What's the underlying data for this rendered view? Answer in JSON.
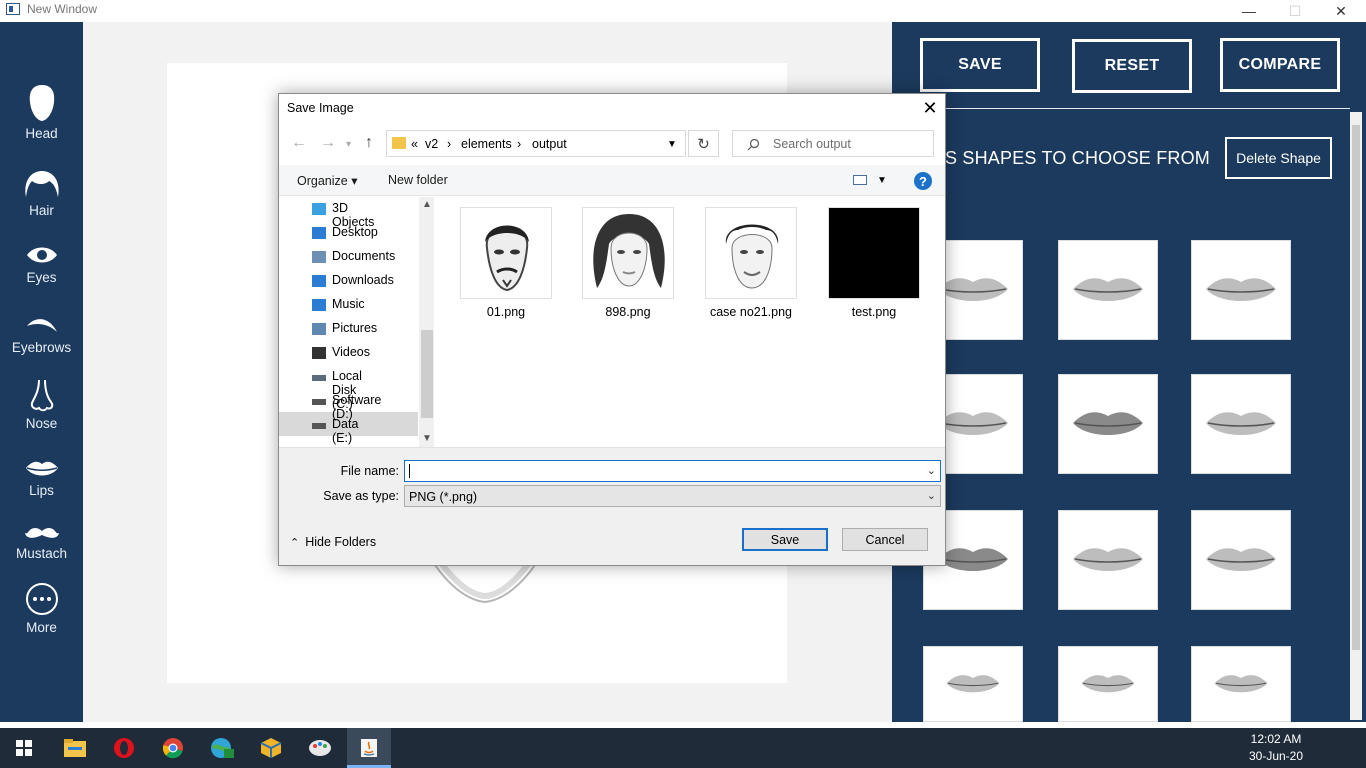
{
  "window": {
    "title": "New Window",
    "min": "—",
    "max": "☐",
    "close": "✕"
  },
  "left_nav": [
    {
      "label": "Head",
      "icon": "head-icon"
    },
    {
      "label": "Hair",
      "icon": "hair-icon"
    },
    {
      "label": "Eyes",
      "icon": "eye-icon"
    },
    {
      "label": "Eyebrows",
      "icon": "eyebrow-icon"
    },
    {
      "label": "Nose",
      "icon": "nose-icon"
    },
    {
      "label": "Lips",
      "icon": "lips-icon"
    },
    {
      "label": "Mustach",
      "icon": "mustache-icon"
    },
    {
      "label": "More",
      "icon": "more-icon"
    }
  ],
  "right_panel": {
    "save_label": "SAVE",
    "reset_label": "RESET",
    "compare_label": "COMPARE",
    "shapes_title": "S SHAPES TO CHOOSE FROM",
    "delete_label": "Delete Shape"
  },
  "dialog": {
    "title": "Save Image",
    "close": "✕",
    "breadcrumb": [
      "«",
      "v2",
      "›",
      "elements",
      "›",
      "output"
    ],
    "search_placeholder": "Search output",
    "organize_label": "Organize ▾",
    "new_folder_label": "New folder",
    "help": "?",
    "tree": [
      "3D Objects",
      "Desktop",
      "Documents",
      "Downloads",
      "Music",
      "Pictures",
      "Videos",
      "Local Disk (C:)",
      "Software (D:)",
      "Data (E:)"
    ],
    "files": [
      "01.png",
      "898.png",
      "case no21.png",
      "test.png"
    ],
    "file_name_label": "File name:",
    "file_name_value": "",
    "save_type_label": "Save as type:",
    "save_type_value": "PNG (*.png)",
    "save_label": "Save",
    "cancel_label": "Cancel",
    "hide_folders_label": "Hide Folders"
  },
  "taskbar": {
    "time": "12:02 AM",
    "date": "30-Jun-20",
    "apps": [
      "start-icon",
      "file-explorer-icon",
      "opera-icon",
      "chrome-icon",
      "app-icon",
      "box-app-icon",
      "paint-app-icon",
      "java-icon"
    ]
  },
  "colors": {
    "panel": "#1c3a5e",
    "taskbar": "#1f2b38",
    "accent": "#1a6fc9"
  }
}
